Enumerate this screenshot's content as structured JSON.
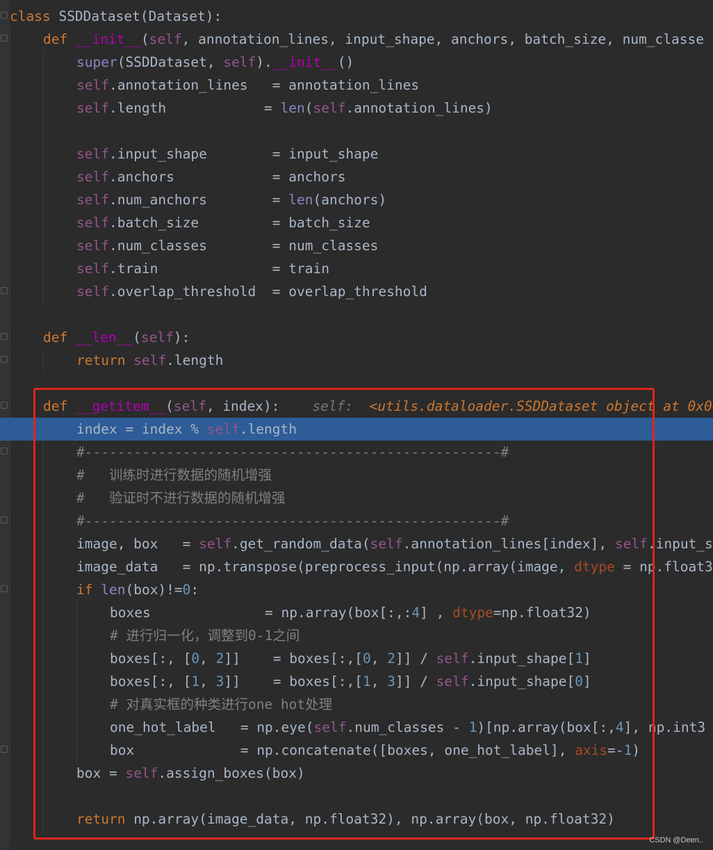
{
  "editor": {
    "lines": [
      {
        "tokens": [
          {
            "t": "class ",
            "c": "kw"
          },
          {
            "t": "SSDDataset(Dataset):",
            "c": ""
          }
        ]
      },
      {
        "tokens": [
          {
            "t": "def ",
            "c": "kw"
          },
          {
            "t": "__init__",
            "c": "dunder"
          },
          {
            "t": "(",
            "c": ""
          },
          {
            "t": "self",
            "c": "self"
          },
          {
            "t": ", annotation_lines, input_shape, anchors, batch_size, num_classe",
            "c": ""
          }
        ]
      },
      {
        "tokens": [
          {
            "t": "super",
            "c": "bi"
          },
          {
            "t": "(SSDDataset, ",
            "c": ""
          },
          {
            "t": "self",
            "c": "self"
          },
          {
            "t": ").",
            "c": ""
          },
          {
            "t": "__init__",
            "c": "dunder"
          },
          {
            "t": "()",
            "c": ""
          }
        ]
      },
      {
        "tokens": [
          {
            "t": "self",
            "c": "self"
          },
          {
            "t": ".annotation_lines   = annotation_lines",
            "c": ""
          }
        ]
      },
      {
        "tokens": [
          {
            "t": "self",
            "c": "self"
          },
          {
            "t": ".length            = ",
            "c": ""
          },
          {
            "t": "len",
            "c": "bi"
          },
          {
            "t": "(",
            "c": ""
          },
          {
            "t": "self",
            "c": "self"
          },
          {
            "t": ".annotation_lines)",
            "c": ""
          }
        ]
      },
      {
        "tokens": []
      },
      {
        "tokens": [
          {
            "t": "self",
            "c": "self"
          },
          {
            "t": ".input_shape        = input_shape",
            "c": ""
          }
        ]
      },
      {
        "tokens": [
          {
            "t": "self",
            "c": "self"
          },
          {
            "t": ".anchors            = anchors",
            "c": ""
          }
        ]
      },
      {
        "tokens": [
          {
            "t": "self",
            "c": "self"
          },
          {
            "t": ".num_anchors        = ",
            "c": ""
          },
          {
            "t": "len",
            "c": "bi"
          },
          {
            "t": "(anchors)",
            "c": ""
          }
        ]
      },
      {
        "tokens": [
          {
            "t": "self",
            "c": "self"
          },
          {
            "t": ".batch_size         = batch_size",
            "c": ""
          }
        ]
      },
      {
        "tokens": [
          {
            "t": "self",
            "c": "self"
          },
          {
            "t": ".num_classes        = num_classes",
            "c": ""
          }
        ]
      },
      {
        "tokens": [
          {
            "t": "self",
            "c": "self"
          },
          {
            "t": ".train              = train",
            "c": ""
          }
        ]
      },
      {
        "tokens": [
          {
            "t": "self",
            "c": "self"
          },
          {
            "t": ".overlap_threshold  = overlap_threshold",
            "c": ""
          }
        ]
      },
      {
        "tokens": []
      },
      {
        "tokens": [
          {
            "t": "def ",
            "c": "kw"
          },
          {
            "t": "__len__",
            "c": "dunder"
          },
          {
            "t": "(",
            "c": ""
          },
          {
            "t": "self",
            "c": "self"
          },
          {
            "t": "):",
            "c": ""
          }
        ]
      },
      {
        "tokens": [
          {
            "t": "return ",
            "c": "kw"
          },
          {
            "t": "self",
            "c": "self"
          },
          {
            "t": ".length",
            "c": ""
          }
        ]
      },
      {
        "tokens": []
      },
      {
        "tokens": [
          {
            "t": "def ",
            "c": "kw"
          },
          {
            "t": "__getitem__",
            "c": "dunder"
          },
          {
            "t": "(",
            "c": ""
          },
          {
            "t": "self",
            "c": "self"
          },
          {
            "t": ", index):",
            "c": ""
          }
        ]
      },
      {
        "tokens": [
          {
            "t": "index = index % ",
            "c": ""
          },
          {
            "t": "self",
            "c": "self"
          },
          {
            "t": ".length",
            "c": ""
          }
        ]
      },
      {
        "tokens": [
          {
            "t": "#---------------------------------------------------#",
            "c": "comment"
          }
        ]
      },
      {
        "tokens": [
          {
            "t": "#   训练时进行数据的随机增强",
            "c": "comment"
          }
        ]
      },
      {
        "tokens": [
          {
            "t": "#   验证时不进行数据的随机增强",
            "c": "comment"
          }
        ]
      },
      {
        "tokens": [
          {
            "t": "#---------------------------------------------------#",
            "c": "comment"
          }
        ]
      },
      {
        "tokens": [
          {
            "t": "image, box   = ",
            "c": ""
          },
          {
            "t": "self",
            "c": "self"
          },
          {
            "t": ".get_random_data(",
            "c": ""
          },
          {
            "t": "self",
            "c": "self"
          },
          {
            "t": ".annotation_lines[index], ",
            "c": ""
          },
          {
            "t": "self",
            "c": "self"
          },
          {
            "t": ".input_s",
            "c": ""
          }
        ]
      },
      {
        "tokens": [
          {
            "t": "image_data   = np.transpose(preprocess_input(np.array(image, ",
            "c": ""
          },
          {
            "t": "dtype",
            "c": "param"
          },
          {
            "t": " = np.float3",
            "c": ""
          }
        ]
      },
      {
        "tokens": [
          {
            "t": "if ",
            "c": "kw"
          },
          {
            "t": "len",
            "c": "bi"
          },
          {
            "t": "(box)!=",
            "c": ""
          },
          {
            "t": "0",
            "c": "num"
          },
          {
            "t": ":",
            "c": ""
          }
        ]
      },
      {
        "tokens": [
          {
            "t": "boxes              = np.array(box[:,:",
            "c": ""
          },
          {
            "t": "4",
            "c": "num"
          },
          {
            "t": "] , ",
            "c": ""
          },
          {
            "t": "dtype",
            "c": "param"
          },
          {
            "t": "=np.float32)",
            "c": ""
          }
        ]
      },
      {
        "tokens": [
          {
            "t": "# 进行归一化，调整到0-1之间",
            "c": "comment"
          }
        ]
      },
      {
        "tokens": [
          {
            "t": "boxes[:, [",
            "c": ""
          },
          {
            "t": "0",
            "c": "num"
          },
          {
            "t": ", ",
            "c": ""
          },
          {
            "t": "2",
            "c": "num"
          },
          {
            "t": "]]    = boxes[:,[",
            "c": ""
          },
          {
            "t": "0",
            "c": "num"
          },
          {
            "t": ", ",
            "c": ""
          },
          {
            "t": "2",
            "c": "num"
          },
          {
            "t": "]] / ",
            "c": ""
          },
          {
            "t": "self",
            "c": "self"
          },
          {
            "t": ".input_shape[",
            "c": ""
          },
          {
            "t": "1",
            "c": "num"
          },
          {
            "t": "]",
            "c": ""
          }
        ]
      },
      {
        "tokens": [
          {
            "t": "boxes[:, [",
            "c": ""
          },
          {
            "t": "1",
            "c": "num"
          },
          {
            "t": ", ",
            "c": ""
          },
          {
            "t": "3",
            "c": "num"
          },
          {
            "t": "]]    = boxes[:,[",
            "c": ""
          },
          {
            "t": "1",
            "c": "num"
          },
          {
            "t": ", ",
            "c": ""
          },
          {
            "t": "3",
            "c": "num"
          },
          {
            "t": "]] / ",
            "c": ""
          },
          {
            "t": "self",
            "c": "self"
          },
          {
            "t": ".input_shape[",
            "c": ""
          },
          {
            "t": "0",
            "c": "num"
          },
          {
            "t": "]",
            "c": ""
          }
        ]
      },
      {
        "tokens": [
          {
            "t": "# 对真实框的种类进行one hot处理",
            "c": "comment"
          }
        ]
      },
      {
        "tokens": [
          {
            "t": "one_hot_label   = np.eye(",
            "c": ""
          },
          {
            "t": "self",
            "c": "self"
          },
          {
            "t": ".num_classes - ",
            "c": ""
          },
          {
            "t": "1",
            "c": "num"
          },
          {
            "t": ")[np.array(box[:,",
            "c": ""
          },
          {
            "t": "4",
            "c": "num"
          },
          {
            "t": "], np.int3",
            "c": ""
          }
        ]
      },
      {
        "tokens": [
          {
            "t": "box             = np.concatenate([boxes, one_hot_label], ",
            "c": ""
          },
          {
            "t": "axis",
            "c": "param"
          },
          {
            "t": "=-",
            "c": ""
          },
          {
            "t": "1",
            "c": "num"
          },
          {
            "t": ")",
            "c": ""
          }
        ]
      },
      {
        "tokens": [
          {
            "t": "box = ",
            "c": ""
          },
          {
            "t": "self",
            "c": "self"
          },
          {
            "t": ".assign_boxes(box)",
            "c": ""
          }
        ]
      },
      {
        "tokens": []
      },
      {
        "tokens": [
          {
            "t": "return ",
            "c": "kw"
          },
          {
            "t": "np.array(image_data, np.float32), np.array(box, np.float32)",
            "c": ""
          }
        ]
      }
    ],
    "inline_hint_label": "self:",
    "inline_hint_value": "<utils.dataloader.SSDDataset object at 0x00"
  },
  "watermark": "CSDN @Deen.."
}
